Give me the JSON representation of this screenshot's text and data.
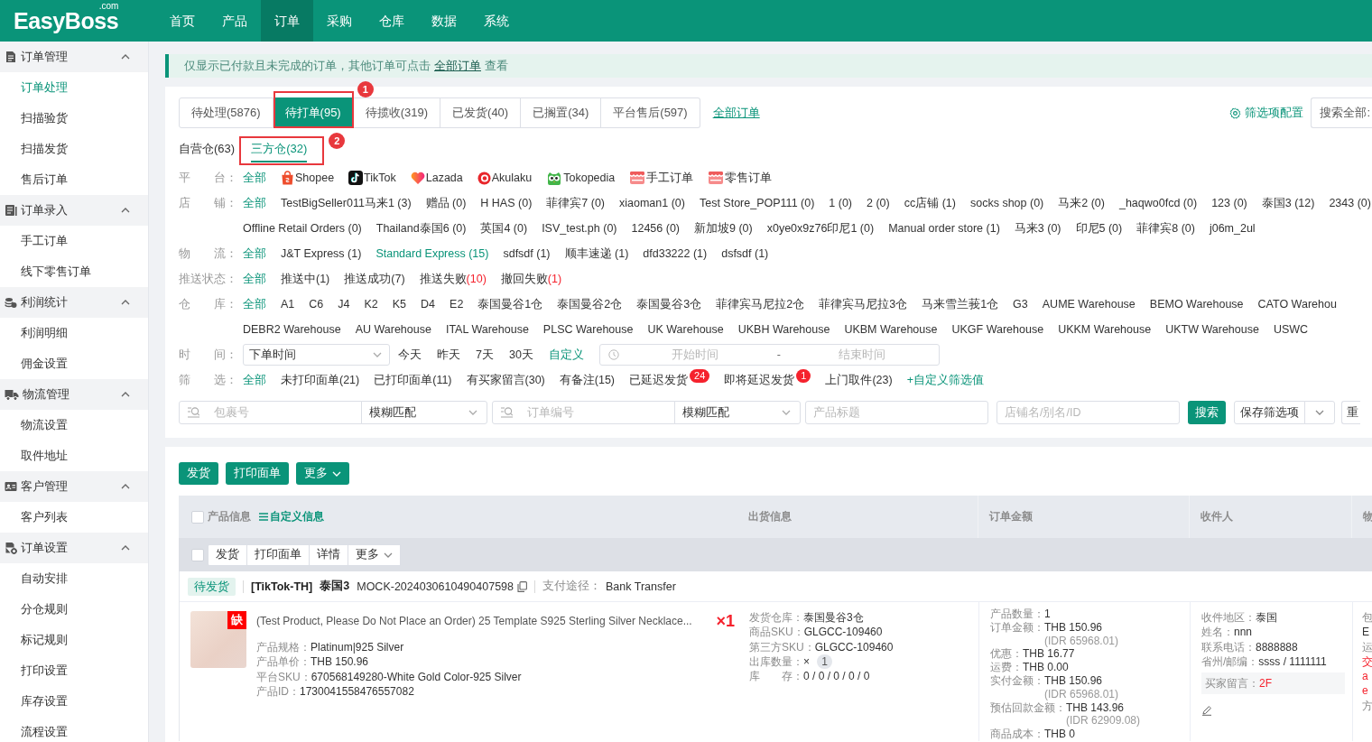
{
  "header": {
    "logo": "EasyBoss",
    "logo_suffix": ".com",
    "nav": [
      {
        "label": "首页",
        "selected": false
      },
      {
        "label": "产品",
        "selected": false
      },
      {
        "label": "订单",
        "selected": true
      },
      {
        "label": "采购",
        "selected": false
      },
      {
        "label": "仓库",
        "selected": false
      },
      {
        "label": "数据",
        "selected": false
      },
      {
        "label": "系统",
        "selected": false
      }
    ]
  },
  "sidebar": {
    "groups": [
      {
        "title": "订单管理",
        "expanded": true,
        "items": [
          {
            "label": "订单处理",
            "selected": true
          },
          {
            "label": "扫描验货",
            "selected": false
          },
          {
            "label": "扫描发货",
            "selected": false
          },
          {
            "label": "售后订单",
            "selected": false
          }
        ]
      },
      {
        "title": "订单录入",
        "expanded": true,
        "items": [
          {
            "label": "手工订单",
            "selected": false
          },
          {
            "label": "线下零售订单",
            "selected": false
          }
        ]
      },
      {
        "title": "利润统计",
        "expanded": true,
        "items": [
          {
            "label": "利润明细",
            "selected": false
          },
          {
            "label": "佣金设置",
            "selected": false
          }
        ]
      },
      {
        "title": "物流管理",
        "expanded": true,
        "items": [
          {
            "label": "物流设置",
            "selected": false
          },
          {
            "label": "取件地址",
            "selected": false
          }
        ]
      },
      {
        "title": "客户管理",
        "expanded": true,
        "items": [
          {
            "label": "客户列表",
            "selected": false
          }
        ]
      },
      {
        "title": "订单设置",
        "expanded": true,
        "items": [
          {
            "label": "自动安排",
            "selected": false
          },
          {
            "label": "分仓规则",
            "selected": false
          },
          {
            "label": "标记规则",
            "selected": false
          },
          {
            "label": "打印设置",
            "selected": false
          },
          {
            "label": "库存设置",
            "selected": false
          },
          {
            "label": "流程设置",
            "selected": false
          }
        ]
      }
    ]
  },
  "notice": {
    "text": "仅显示已付款且未完成的订单，其他订单可点击",
    "link": "全部订单",
    "suffix": "查看"
  },
  "status_tabs": [
    {
      "label": "待处理(5876)",
      "selected": false
    },
    {
      "label": "待打单(95)",
      "selected": true,
      "annotation": "1"
    },
    {
      "label": "待揽收(319)",
      "selected": false
    },
    {
      "label": "已发货(40)",
      "selected": false
    },
    {
      "label": "已搁置(34)",
      "selected": false
    },
    {
      "label": "平台售后(597)",
      "selected": false
    }
  ],
  "all_orders_link": "全部订单",
  "filter_config": "筛选项配置",
  "search_scope": "搜索全部:",
  "warehouse_tabs": [
    {
      "label": "自营仓(63)",
      "selected": false
    },
    {
      "label": "三方仓(32)",
      "selected": true,
      "annotation": "2"
    }
  ],
  "filters": [
    {
      "kind": "platforms",
      "label": "平　　台：",
      "options": [
        {
          "label": "全部",
          "selected": true
        },
        {
          "label": "Shopee",
          "selected": false
        },
        {
          "label": "TikTok",
          "selected": false
        },
        {
          "label": "Lazada",
          "selected": false
        },
        {
          "label": "Akulaku",
          "selected": false
        },
        {
          "label": "Tokopedia",
          "selected": false
        },
        {
          "label": "手工订单",
          "selected": false
        },
        {
          "label": "零售订单",
          "selected": false
        }
      ]
    },
    {
      "kind": "options",
      "label": "店　　铺：",
      "options": [
        {
          "label": "全部",
          "selected": true
        },
        {
          "label": "TestBigSeller011马来1 (3)",
          "selected": false
        },
        {
          "label": "赠品 (0)",
          "selected": false
        },
        {
          "label": "H HAS (0)",
          "selected": false
        },
        {
          "label": "菲律宾7 (0)",
          "selected": false
        },
        {
          "label": "xiaoman1 (0)",
          "selected": false
        },
        {
          "label": "Test Store_POP111 (0)",
          "selected": false
        },
        {
          "label": "1 (0)",
          "selected": false
        },
        {
          "label": "2 (0)",
          "selected": false
        },
        {
          "label": "cc店铺 (1)",
          "selected": false
        },
        {
          "label": "socks shop (0)",
          "selected": false
        },
        {
          "label": "马来2 (0)",
          "selected": false
        },
        {
          "label": "_haqwo0fcd (0)",
          "selected": false
        },
        {
          "label": "123 (0)",
          "selected": false
        },
        {
          "label": "泰国3 (12)",
          "selected": false
        },
        {
          "label": "2343 (0)",
          "selected": false
        },
        {
          "label": "Offline Retail Orders (0)",
          "selected": false
        },
        {
          "label": "Thailand泰国6 (0)",
          "selected": false
        },
        {
          "label": "英国4 (0)",
          "selected": false
        },
        {
          "label": "ISV_test.ph (0)",
          "selected": false
        },
        {
          "label": "12456 (0)",
          "selected": false
        },
        {
          "label": "新加坡9 (0)",
          "selected": false
        },
        {
          "label": "x0ye0x9z76印尼1 (0)",
          "selected": false
        },
        {
          "label": "Manual order store (1)",
          "selected": false
        },
        {
          "label": "马来3 (0)",
          "selected": false
        },
        {
          "label": "印尼5 (0)",
          "selected": false
        },
        {
          "label": "菲律宾8 (0)",
          "selected": false
        },
        {
          "label": "j06m_2ul",
          "selected": false
        }
      ]
    },
    {
      "kind": "options",
      "label": "物　　流：",
      "options": [
        {
          "label": "全部",
          "selected": true
        },
        {
          "label": "J&T Express (1)",
          "selected": false
        },
        {
          "label": "Standard Express (15)",
          "selected": true
        },
        {
          "label": "sdfsdf (1)",
          "selected": false
        },
        {
          "label": "顺丰速递 (1)",
          "selected": false
        },
        {
          "label": "dfd33222 (1)",
          "selected": false
        },
        {
          "label": "dsfsdf (1)",
          "selected": false
        }
      ]
    },
    {
      "kind": "status",
      "label": "推送状态：",
      "options": [
        {
          "label": "全部",
          "selected": true
        },
        {
          "label": "推送中",
          "count": "(1)",
          "alert": false,
          "selected": false
        },
        {
          "label": "推送成功",
          "count": "(7)",
          "alert": false,
          "selected": false
        },
        {
          "label": "推送失败",
          "count": "(10)",
          "alert": true,
          "selected": false
        },
        {
          "label": "撤回失败",
          "count": "(1)",
          "alert": true,
          "selected": false
        }
      ]
    },
    {
      "kind": "options",
      "label": "仓　　库：",
      "options": [
        {
          "label": "全部",
          "selected": true
        },
        {
          "label": "A1",
          "selected": false
        },
        {
          "label": "C6",
          "selected": false
        },
        {
          "label": "J4",
          "selected": false
        },
        {
          "label": "K2",
          "selected": false
        },
        {
          "label": "K5",
          "selected": false
        },
        {
          "label": "D4",
          "selected": false
        },
        {
          "label": "E2",
          "selected": false
        },
        {
          "label": "泰国曼谷1仓",
          "selected": false
        },
        {
          "label": "泰国曼谷2仓",
          "selected": false
        },
        {
          "label": "泰国曼谷3仓",
          "selected": false
        },
        {
          "label": "菲律宾马尼拉2仓",
          "selected": false
        },
        {
          "label": "菲律宾马尼拉3仓",
          "selected": false
        },
        {
          "label": "马来雪兰莪1仓",
          "selected": false
        },
        {
          "label": "G3",
          "selected": false
        },
        {
          "label": "AUME Warehouse",
          "selected": false
        },
        {
          "label": "BEMO Warehouse",
          "selected": false
        },
        {
          "label": "CATO Warehou",
          "selected": false
        },
        {
          "label": "DEBR2 Warehouse",
          "selected": false
        },
        {
          "label": "AU Warehouse",
          "selected": false
        },
        {
          "label": "ITAL Warehouse",
          "selected": false
        },
        {
          "label": "PLSC Warehouse",
          "selected": false
        },
        {
          "label": "UK Warehouse",
          "selected": false
        },
        {
          "label": "UKBH Warehouse",
          "selected": false
        },
        {
          "label": "UKBM Warehouse",
          "selected": false
        },
        {
          "label": "UKGF Warehouse",
          "selected": false
        },
        {
          "label": "UKKM Warehouse",
          "selected": false
        },
        {
          "label": "UKTW Warehouse",
          "selected": false
        },
        {
          "label": "USWC",
          "selected": false
        }
      ]
    },
    {
      "kind": "time",
      "label": "时　　间：",
      "field": "下单时间",
      "quick": [
        {
          "label": "今天",
          "selected": false
        },
        {
          "label": "昨天",
          "selected": false
        },
        {
          "label": "7天",
          "selected": false
        },
        {
          "label": "30天",
          "selected": false
        }
      ],
      "custom": "自定义",
      "start_placeholder": "开始时间",
      "separator": "-",
      "end_placeholder": "结束时间"
    },
    {
      "kind": "flags",
      "label": "筛　　选：",
      "options": [
        {
          "label": "全部",
          "selected": true
        },
        {
          "label": "未打印面单(21)",
          "selected": false
        },
        {
          "label": "已打印面单(11)",
          "selected": false
        },
        {
          "label": "有买家留言(30)",
          "selected": false
        },
        {
          "label": "有备注(15)",
          "selected": false
        },
        {
          "label": "已延迟发货",
          "badge": "24",
          "selected": false
        },
        {
          "label": "即将延迟发货",
          "badge": "1",
          "selected": false
        },
        {
          "label": "上门取件(23)",
          "selected": false
        }
      ],
      "add_link": "+自定义筛选值"
    }
  ],
  "search": {
    "fields": [
      {
        "kind": "combo",
        "placeholder": "包裹号",
        "mode": "模糊匹配"
      },
      {
        "kind": "combo",
        "placeholder": "订单编号",
        "mode": "模糊匹配"
      },
      {
        "kind": "text",
        "placeholder": "产品标题"
      },
      {
        "kind": "text",
        "placeholder": "店铺名/别名/ID"
      }
    ],
    "search_button": "搜索",
    "save_button": "保存筛选项",
    "reset_button": "重"
  },
  "actions": [
    {
      "label": "发货",
      "kind": "button"
    },
    {
      "label": "打印面单",
      "kind": "button"
    },
    {
      "label": "更多",
      "kind": "menu"
    }
  ],
  "table": {
    "select_all_checked": false,
    "columns": [
      "产品信息",
      "出货信息",
      "订单金额",
      "收件人",
      "物"
    ],
    "custom_info": "自定义信息",
    "batch": {
      "checked": false,
      "buttons": [
        {
          "label": "发货",
          "kind": "button"
        },
        {
          "label": "打印面单",
          "kind": "button"
        },
        {
          "label": "详情",
          "kind": "button"
        },
        {
          "label": "更多",
          "kind": "menu"
        }
      ]
    },
    "orders": [
      {
        "status": "待发货",
        "platform": "[TikTok-TH]",
        "shop": "泰国3",
        "order_no": "MOCK-2024030610490407598",
        "payment_label": "支付途径：",
        "payment": "Bank Transfer",
        "product": {
          "title": "(Test Product, Please Do Not Place an Order) 25 Template S925 Sterling Silver Necklace...",
          "badge": "缺",
          "quantity": "×1",
          "fields": [
            {
              "label": "产品规格：",
              "value": "Platinum|925 Silver"
            },
            {
              "label": "产品单价：",
              "value": "THB 150.96"
            },
            {
              "label": "平台SKU：",
              "value": "670568149280-White Gold Color-925 Silver"
            },
            {
              "label": "产品ID：",
              "value": "1730041558476557082"
            }
          ]
        },
        "shipping": [
          {
            "label": "发货仓库：",
            "value": "泰国曼谷3仓"
          },
          {
            "label": "商品SKU：",
            "value": "GLGCC-109460"
          },
          {
            "label": "第三方SKU：",
            "value": "GLGCC-109460"
          },
          {
            "label": "出库数量：",
            "value": "×",
            "count": "1"
          },
          {
            "label": "库　　存：",
            "value": "0 / 0 / 0 / 0 / 0"
          }
        ],
        "amounts": [
          {
            "label": "产品数量：",
            "value": "1"
          },
          {
            "label": "订单金额：",
            "value": "THB 150.96",
            "sub": "(IDR 65968.01)"
          },
          {
            "label": "优惠：",
            "value": "THB 16.77"
          },
          {
            "label": "运费：",
            "value": "THB 0.00"
          },
          {
            "label": "实付金额：",
            "value": "THB 150.96",
            "sub": "(IDR 65968.01)"
          },
          {
            "label": "预估回款金额：",
            "value": "THB 143.96",
            "sub": "(IDR 62909.08)"
          },
          {
            "label": "商品成本：",
            "value": "THB 0"
          }
        ],
        "recipient": {
          "fields": [
            {
              "label": "收件地区：",
              "value": "泰国"
            },
            {
              "label": "姓名：",
              "value": "nnn"
            },
            {
              "label": "联系电话：",
              "value": "8888888"
            },
            {
              "label": "省州/邮编：",
              "value": "ssss / 1111111"
            }
          ],
          "note_label": "买家留言：",
          "note": "2F"
        },
        "column_5": [
          {
            "text": "包",
            "kind": "label"
          },
          {
            "text": "E",
            "kind": "value"
          },
          {
            "text": "运",
            "kind": "label"
          },
          {
            "text": "交",
            "kind": "warning"
          },
          {
            "text": "a",
            "kind": "warning"
          },
          {
            "text": "e",
            "kind": "warning"
          },
          {
            "text": "方",
            "kind": "label"
          }
        ]
      }
    ]
  }
}
